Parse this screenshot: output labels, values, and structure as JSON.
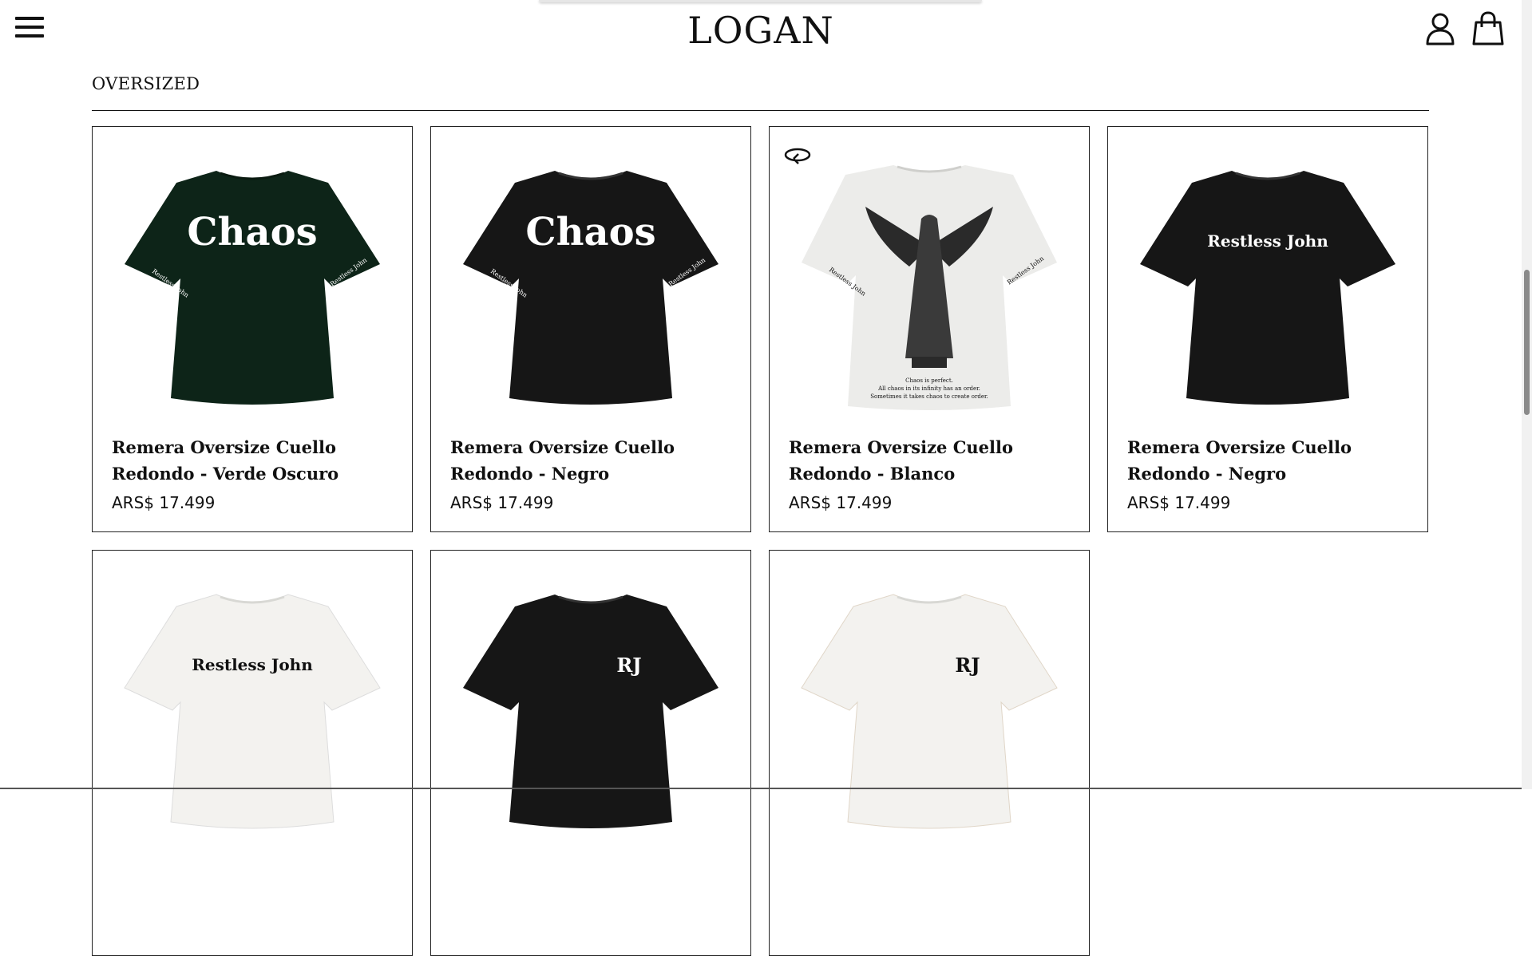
{
  "header": {
    "logo": "LOGAN",
    "menu_icon": "hamburger-menu-icon",
    "account_icon": "user-icon",
    "cart_icon": "shopping-bag-icon"
  },
  "section": {
    "title": "OVERSIZED"
  },
  "products": [
    {
      "name": "Remera Oversize Cuello Redondo - Verde Oscuro",
      "price": "ARS$ 17.499",
      "color": "#0d2418",
      "print": "Chaos",
      "sleeve_text": "Restless John"
    },
    {
      "name": "Remera Oversize Cuello Redondo - Negro",
      "price": "ARS$ 17.499",
      "color": "#161616",
      "print": "Chaos",
      "sleeve_text": "Restless John"
    },
    {
      "name": "Remera Oversize Cuello Redondo - Blanco",
      "price": "ARS$ 17.499",
      "color": "#ececea",
      "print": "angel",
      "sleeve_text": "Restless John",
      "caption": [
        "Chaos is perfect.",
        "All chaos in its infinity has an order.",
        "Sometimes it takes chaos to create order."
      ],
      "badge_icon": "rotate-360-icon"
    },
    {
      "name": "Remera Oversize Cuello Redondo - Negro",
      "price": "ARS$ 17.499",
      "color": "#161616",
      "print": "Restless John"
    },
    {
      "name": "",
      "price": "",
      "color": "#f3f2ef",
      "print": "Restless John"
    },
    {
      "name": "",
      "price": "",
      "color": "#161616",
      "print": "RJ"
    },
    {
      "name": "",
      "price": "",
      "color": "#f3f2ef",
      "print": "RJ"
    }
  ],
  "colors": {
    "text": "#111111",
    "border": "#222222",
    "background": "#ffffff"
  }
}
